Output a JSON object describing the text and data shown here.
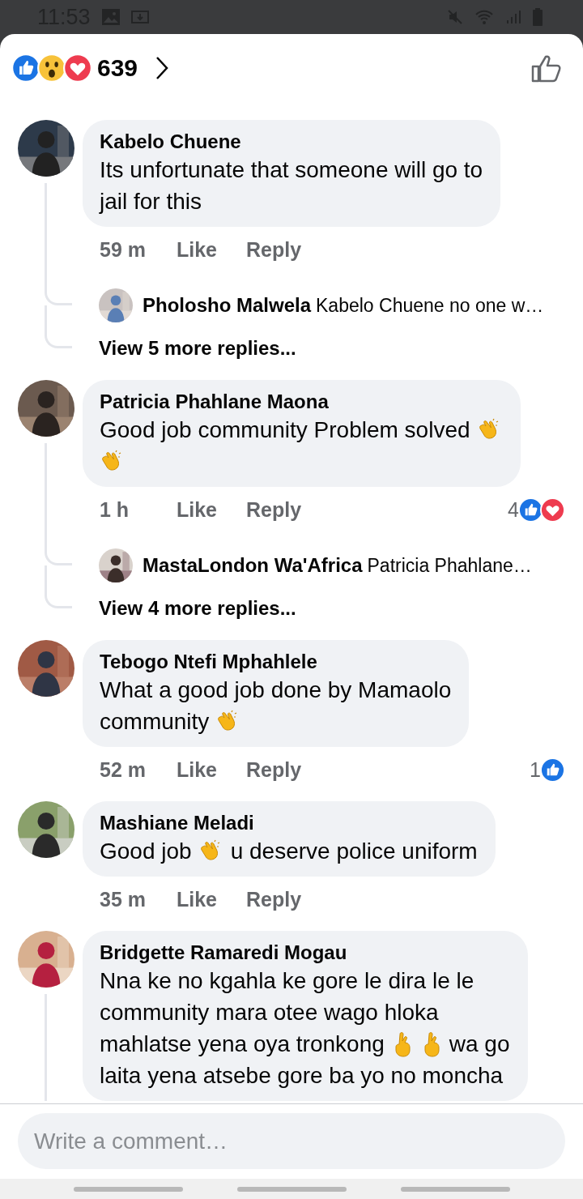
{
  "status_bar": {
    "time": "11:53"
  },
  "header": {
    "reactions": [
      {
        "kind": "like"
      },
      {
        "kind": "wow"
      },
      {
        "kind": "love"
      }
    ],
    "count": "639"
  },
  "comments": [
    {
      "author": "Kabelo Chuene",
      "avatar": {
        "kind": "picture"
      },
      "thread_line": true,
      "lines": [
        [
          {
            "kind": "text",
            "text": "Its unfortunate that someone will go to"
          }
        ],
        [
          {
            "kind": "text",
            "text": "jail for this"
          }
        ]
      ],
      "time": "59 m",
      "like_label": "Like",
      "reply_label": "Reply",
      "replies": [
        {
          "author": "Pholosho Malwela",
          "preview": "Kabelo Chuene no one w…",
          "avatar": {
            "kind": "picture"
          }
        }
      ],
      "more_replies": "View 5 more replies..."
    },
    {
      "author": "Patricia Phahlane Maona",
      "avatar": {
        "kind": "picture"
      },
      "thread_line": true,
      "lines": [
        [
          {
            "kind": "text",
            "text": "Good job community Problem solved"
          },
          {
            "kind": "clap"
          }
        ],
        [
          {
            "kind": "clap"
          }
        ]
      ],
      "time": "1 h",
      "like_label": "Like",
      "reply_label": "Reply",
      "reactions": {
        "count": "4",
        "types": [
          {
            "kind": "like"
          },
          {
            "kind": "love"
          }
        ]
      },
      "replies": [
        {
          "author": "MastaLondon Wa'Africa",
          "preview": "Patricia Phahlane…",
          "avatar": {
            "kind": "picture"
          }
        }
      ],
      "more_replies": "View 4 more replies..."
    },
    {
      "author": "Tebogo Ntefi Mphahlele",
      "avatar": {
        "kind": "picture"
      },
      "thread_line": false,
      "lines": [
        [
          {
            "kind": "text",
            "text": "What a good job done by Mamaolo"
          }
        ],
        [
          {
            "kind": "text",
            "text": "community"
          },
          {
            "kind": "clap"
          }
        ]
      ],
      "time": "52 m",
      "like_label": "Like",
      "reply_label": "Reply",
      "reactions": {
        "count": "1",
        "types": [
          {
            "kind": "like"
          }
        ]
      }
    },
    {
      "author": "Mashiane Meladi",
      "avatar": {
        "kind": "picture"
      },
      "thread_line": false,
      "lines": [
        [
          {
            "kind": "text",
            "text": "Good job"
          },
          {
            "kind": "clap"
          },
          {
            "kind": "text",
            "text": "u deserve police uniform"
          }
        ]
      ],
      "time": "35 m",
      "like_label": "Like",
      "reply_label": "Reply"
    },
    {
      "author": "Bridgette Ramaredi Mogau",
      "avatar": {
        "kind": "picture"
      },
      "thread_line": true,
      "lines": [
        [
          {
            "kind": "text",
            "text": "Nna ke no kgahla ke gore le dira le le"
          }
        ],
        [
          {
            "kind": "text",
            "text": "community mara otee wago hloka"
          }
        ],
        [
          {
            "kind": "text",
            "text": "mahlatse yena oya tronkong"
          },
          {
            "kind": "fingers"
          },
          {
            "kind": "fingers"
          },
          {
            "kind": "text",
            "text": "wa go"
          }
        ],
        [
          {
            "kind": "text",
            "text": "laita yena atsebe gore ba yo no moncha"
          }
        ]
      ]
    }
  ],
  "composer": {
    "placeholder": "Write a comment…"
  }
}
